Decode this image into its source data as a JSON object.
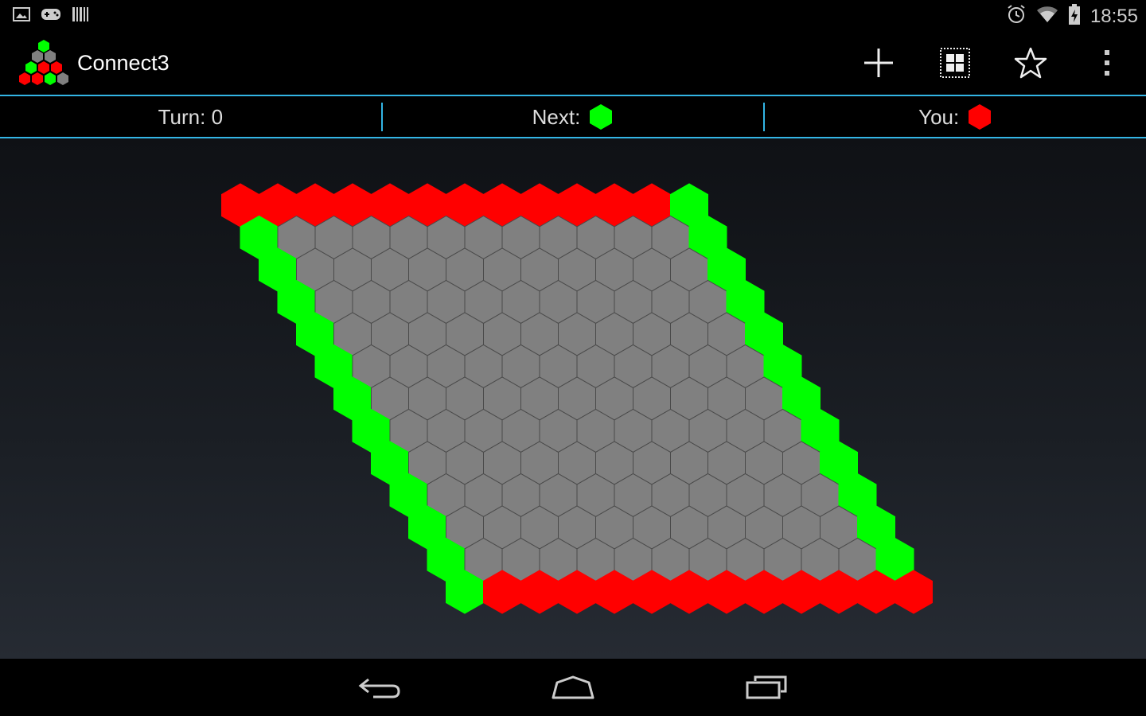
{
  "status": {
    "time": "18:55",
    "left_icons": [
      "image-icon",
      "gamepad-icon",
      "barcode-icon"
    ],
    "right_icons": [
      "alarm-icon",
      "wifi-icon",
      "battery-icon"
    ]
  },
  "app": {
    "title": "Connect3",
    "actions": [
      "new-game-icon",
      "grid-icon",
      "star-icon",
      "overflow-menu-icon"
    ]
  },
  "info": {
    "turn_text": "Turn: 0",
    "next_label": "Next:",
    "next_color": "green",
    "you_label": "You:",
    "you_color": "red"
  },
  "board": {
    "size": 11,
    "colors": {
      "red": "#ff0000",
      "green": "#00ff00",
      "empty": "#808080",
      "accent": "#33b5e5"
    },
    "top_edge": "red",
    "bottom_edge": "red",
    "left_edge": "green",
    "right_edge": "green",
    "cells_filled": 0
  },
  "nav": {
    "buttons": [
      "back-icon",
      "home-icon",
      "recent-apps-icon"
    ]
  }
}
